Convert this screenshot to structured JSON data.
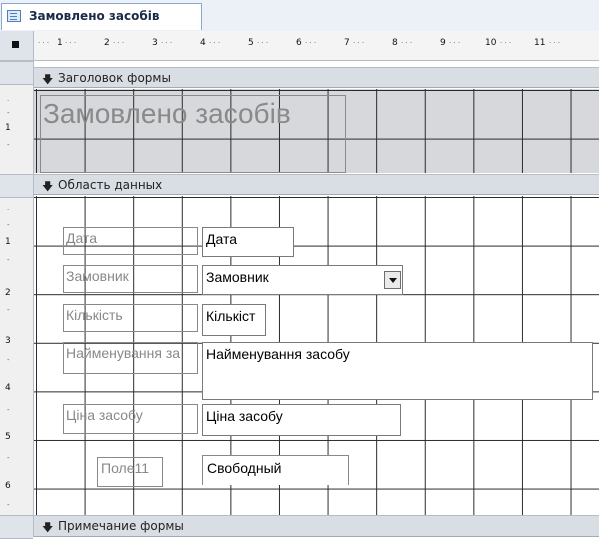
{
  "tab": {
    "title": "Замовлено засобів",
    "icon": "form-icon"
  },
  "ruler": {
    "horizontal_numbers": [
      "1",
      "2",
      "3",
      "4",
      "5",
      "6",
      "7",
      "8",
      "9",
      "10",
      "11"
    ],
    "vertical_numbers": [
      "1",
      "2",
      "3",
      "4",
      "5",
      "6"
    ]
  },
  "sections": {
    "form_header": "Заголовок формы",
    "detail": "Область данных",
    "form_footer": "Примечание формы",
    "section_icon": "section-arrow-icon"
  },
  "header_title": "Замовлено засобів",
  "fields": {
    "date_label": "Дата",
    "date_value": "Дата",
    "customer_label": "Замовник",
    "customer_value": "Замовник",
    "quantity_label": "Кількість",
    "quantity_value": "Кількіст",
    "name_label": "Найменування за",
    "name_value": "Найменування засобу",
    "price_label": "Ціна засобу",
    "price_value": "Ціна засобу",
    "field11_label": "Поле11",
    "field11_value": "Свободный"
  }
}
